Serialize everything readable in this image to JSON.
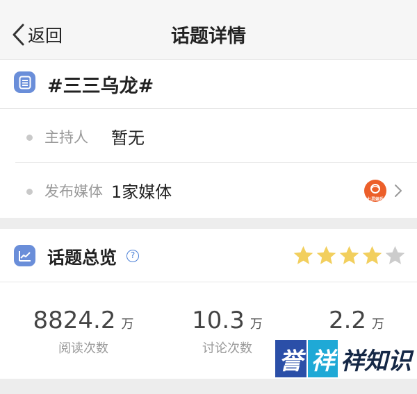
{
  "nav": {
    "back_label": "返回",
    "title": "话题详情"
  },
  "topic": {
    "title": "#三三乌龙#",
    "icon": "document-list-icon",
    "rows": [
      {
        "label": "主持人",
        "value": "暂无"
      },
      {
        "label": "发布媒体",
        "value": "1家媒体",
        "media_logo_text": "七灵娱乐",
        "media_logo_color": "#ec5f2a"
      }
    ]
  },
  "overview": {
    "title": "话题总览",
    "icon": "bar-chart-icon",
    "rating": {
      "filled": 4,
      "total": 5,
      "color_on": "#f2cf5e",
      "color_off": "#cccccc"
    },
    "stats": [
      {
        "value": "8824.2",
        "unit": "万",
        "label": "阅读次数"
      },
      {
        "value": "10.3",
        "unit": "万",
        "label": "讨论次数"
      },
      {
        "value": "2.2",
        "unit": "万",
        "label": ""
      }
    ]
  },
  "watermark": {
    "char1": "誉",
    "char2": "祥",
    "rest": "祥知识"
  },
  "colors": {
    "accent": "#6a8ed9",
    "help_blue": "#4a7fd6",
    "band": "#ededed"
  }
}
